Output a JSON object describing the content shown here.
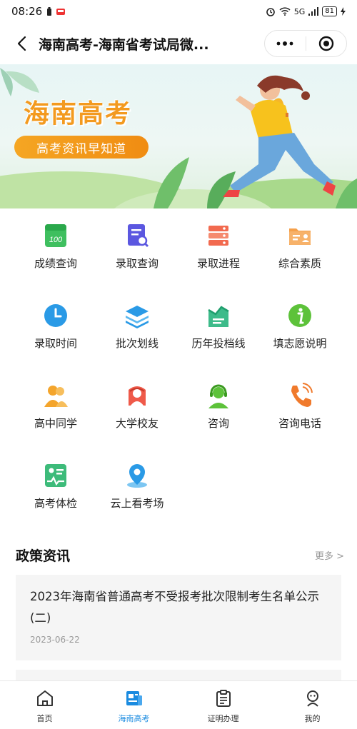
{
  "status": {
    "time": "08:26",
    "signal": "5G",
    "battery": "81"
  },
  "titlebar": {
    "title": "海南高考-海南省考试局微..."
  },
  "banner": {
    "title": "海南高考",
    "subtitle": "高考资讯早知道"
  },
  "grid": {
    "items": [
      {
        "label": "成绩查询",
        "icon": "score-report-icon"
      },
      {
        "label": "录取查询",
        "icon": "admission-search-icon"
      },
      {
        "label": "录取进程",
        "icon": "admission-progress-icon"
      },
      {
        "label": "综合素质",
        "icon": "profile-card-icon"
      },
      {
        "label": "录取时间",
        "icon": "clock-icon"
      },
      {
        "label": "批次划线",
        "icon": "layers-icon"
      },
      {
        "label": "历年投档线",
        "icon": "chart-book-icon"
      },
      {
        "label": "填志愿说明",
        "icon": "info-icon"
      },
      {
        "label": "高中同学",
        "icon": "classmates-icon"
      },
      {
        "label": "大学校友",
        "icon": "alumni-icon"
      },
      {
        "label": "咨询",
        "icon": "headset-agent-icon"
      },
      {
        "label": "咨询电话",
        "icon": "phone-icon"
      },
      {
        "label": "高考体检",
        "icon": "health-check-icon"
      },
      {
        "label": "云上看考场",
        "icon": "location-pin-icon"
      }
    ]
  },
  "news": {
    "title": "政策资讯",
    "more": "更多 >",
    "items": [
      {
        "title": "2023年海南省普通高考不受报考批次限制考生名单公示(二)",
        "date": "2023-06-22"
      }
    ]
  },
  "tabbar": {
    "tabs": [
      {
        "label": "首页",
        "icon": "home-icon"
      },
      {
        "label": "海南高考",
        "icon": "news-icon"
      },
      {
        "label": "证明办理",
        "icon": "clipboard-icon"
      },
      {
        "label": "我的",
        "icon": "user-icon"
      }
    ],
    "active_index": 1
  },
  "colors": {
    "accent": "#1a8be0",
    "banner_orange": "#f39a1f"
  }
}
